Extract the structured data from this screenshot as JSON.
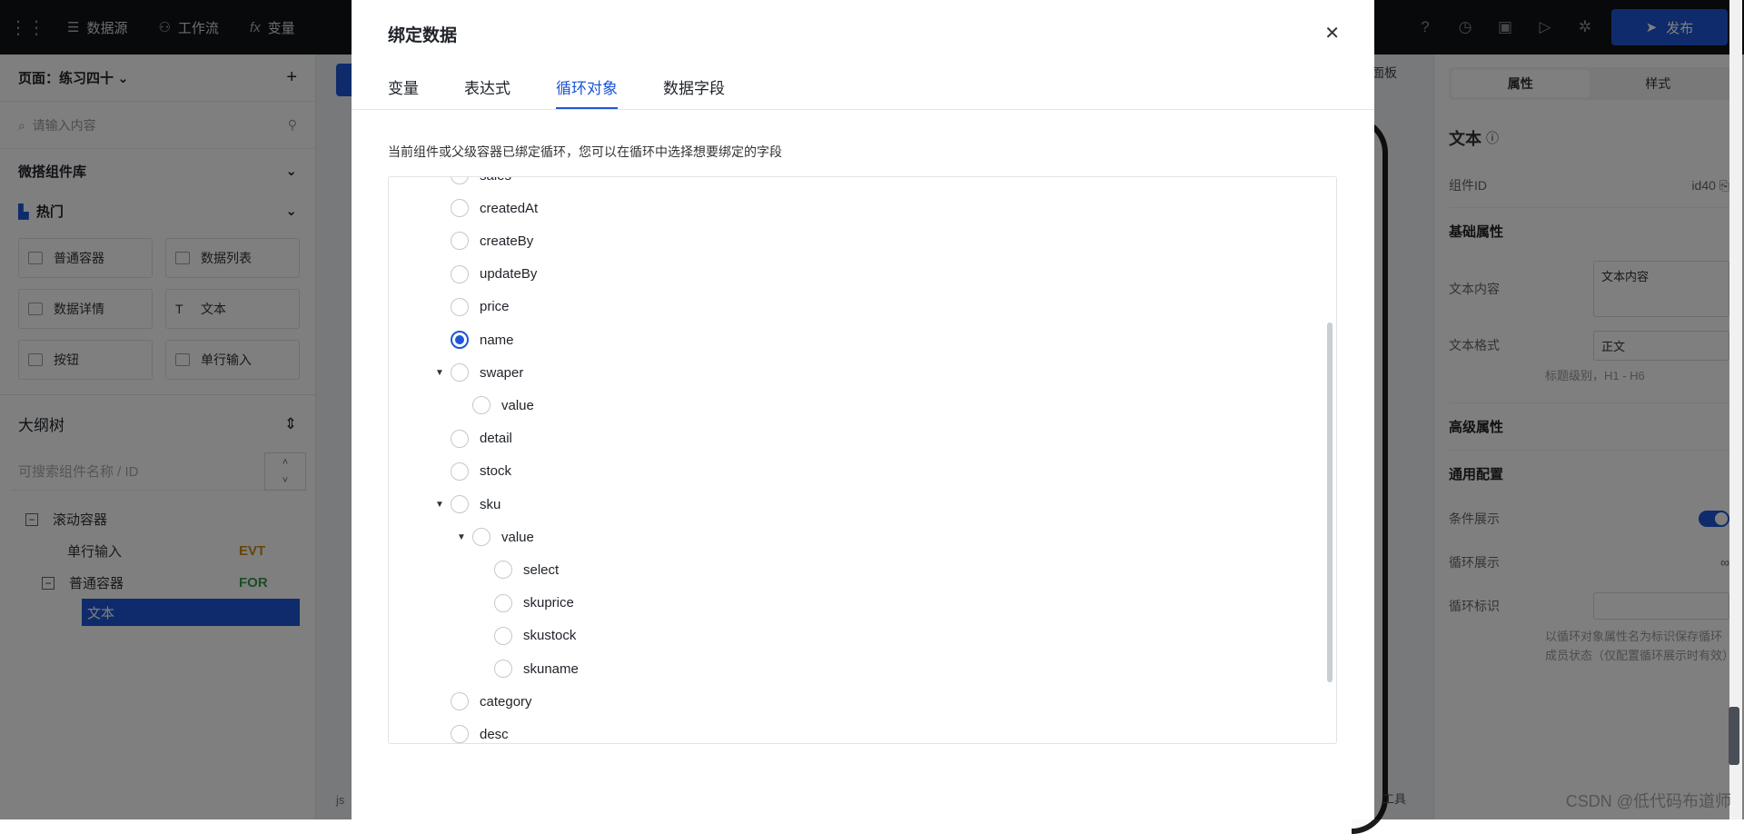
{
  "topbar": {
    "nav": [
      {
        "label": "数据源",
        "icon": "database-icon"
      },
      {
        "label": "工作流",
        "icon": "workflow-icon"
      },
      {
        "label": "变量",
        "icon": "function-icon"
      }
    ],
    "publish_label": "发布"
  },
  "left": {
    "page_title": "页面：练习四十",
    "search_placeholder": "请输入内容",
    "library_title": "微搭组件库",
    "hot_title": "热门",
    "components": [
      "普通容器",
      "数据列表",
      "数据详情",
      "文本",
      "按钮",
      "单行输入"
    ],
    "outline_title": "大纲树",
    "outline_search_placeholder": "可搜索组件名称 / ID",
    "tree": [
      {
        "label": "滚动容器",
        "tag": ""
      },
      {
        "label": "单行输入",
        "tag": "EVT"
      },
      {
        "label": "普通容器",
        "tag": "FOR"
      },
      {
        "label": "文本",
        "tag": ""
      }
    ]
  },
  "canvas": {
    "panel_label": "面板",
    "bottom_left": "js",
    "bottom_right": "工具"
  },
  "right": {
    "tabs": [
      "属性",
      "样式"
    ],
    "component_title": "文本",
    "id_label": "组件ID",
    "id_value": "id40",
    "basic_title": "基础属性",
    "text_content_label": "文本内容",
    "text_content_value": "文本内容",
    "text_format_label": "文本格式",
    "text_format_value": "正文",
    "text_format_hint": "标题级别，H1 - H6",
    "advanced_title": "高级属性",
    "general_title": "通用配置",
    "cond_label": "条件展示",
    "loop_label": "循环展示",
    "loop_key_label": "循环标识",
    "loop_key_hint": "以循环对象属性名为标识保存循环成员状态（仅配置循环展示时有效）"
  },
  "modal": {
    "title": "绑定数据",
    "tabs": [
      "变量",
      "表达式",
      "循环对象",
      "数据字段"
    ],
    "active_tab": 2,
    "description": "当前组件或父级容器已绑定循环，您可以在循环中选择想要绑定的字段",
    "fields": [
      {
        "label": "sales",
        "level": 1,
        "caret": false,
        "checked": false
      },
      {
        "label": "createdAt",
        "level": 1,
        "caret": false,
        "checked": false
      },
      {
        "label": "createBy",
        "level": 1,
        "caret": false,
        "checked": false
      },
      {
        "label": "updateBy",
        "level": 1,
        "caret": false,
        "checked": false
      },
      {
        "label": "price",
        "level": 1,
        "caret": false,
        "checked": false
      },
      {
        "label": "name",
        "level": 1,
        "caret": false,
        "checked": true
      },
      {
        "label": "swaper",
        "level": 1,
        "caret": true,
        "checked": false
      },
      {
        "label": "value",
        "level": 2,
        "caret": false,
        "checked": false
      },
      {
        "label": "detail",
        "level": 1,
        "caret": false,
        "checked": false
      },
      {
        "label": "stock",
        "level": 1,
        "caret": false,
        "checked": false
      },
      {
        "label": "sku",
        "level": 1,
        "caret": true,
        "checked": false
      },
      {
        "label": "value",
        "level": 2,
        "caret": true,
        "checked": false
      },
      {
        "label": "select",
        "level": 3,
        "caret": false,
        "checked": false
      },
      {
        "label": "skuprice",
        "level": 3,
        "caret": false,
        "checked": false
      },
      {
        "label": "skustock",
        "level": 3,
        "caret": false,
        "checked": false
      },
      {
        "label": "skuname",
        "level": 3,
        "caret": false,
        "checked": false
      },
      {
        "label": "category",
        "level": 1,
        "caret": false,
        "checked": false
      },
      {
        "label": "desc",
        "level": 1,
        "caret": false,
        "checked": false
      }
    ]
  },
  "watermark": "CSDN @低代码布道师"
}
